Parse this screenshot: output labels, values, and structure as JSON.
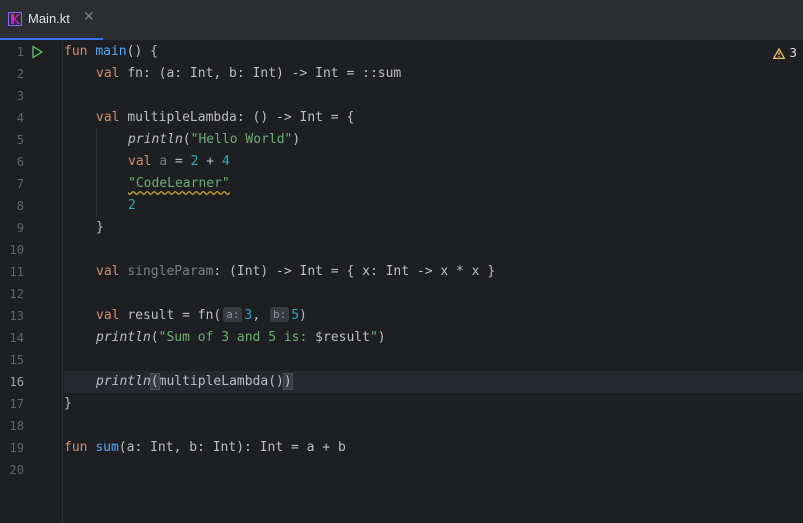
{
  "tab": {
    "filename": "Main.kt",
    "close": "✕"
  },
  "warnings": {
    "count": "3"
  },
  "editor": {
    "current_line": 16,
    "line_numbers": [
      "1",
      "2",
      "3",
      "4",
      "5",
      "6",
      "7",
      "8",
      "9",
      "10",
      "11",
      "12",
      "13",
      "14",
      "15",
      "16",
      "17",
      "18",
      "19",
      "20"
    ]
  },
  "colors": {
    "keyword": "#cf8e6d",
    "function": "#56a8f5",
    "string": "#6aab73",
    "number": "#2aacb8",
    "text": "#bcbec4",
    "accent": "#3574f0"
  },
  "icons": {
    "tab_file": "kotlin-file-icon",
    "run": "run-gutter-icon",
    "warning": "warning-icon"
  },
  "code": {
    "l1": {
      "kw": "fun",
      "fn": "main",
      "rest": "() {"
    },
    "l2": {
      "kw": "val",
      "rest": "fn: (a: Int, b: Int) -> Int = ::sum"
    },
    "l4": {
      "kw": "val",
      "rest": "multipleLambda: () -> Int = {"
    },
    "l5": {
      "call": "println",
      "open": "(",
      "str": "\"Hello World\"",
      "close": ")"
    },
    "l6": {
      "kw": "val",
      "var": "a",
      "eq": "=",
      "n1": "2",
      "plus": "+",
      "n2": "4"
    },
    "l7": {
      "str": "\"CodeLearner\""
    },
    "l8": {
      "num": "2"
    },
    "l9": {
      "text": "}"
    },
    "l11": {
      "kw": "val",
      "var": "singleParam",
      "rest": ": (Int) -> Int = { x: Int -> x * x }"
    },
    "l13": {
      "kw": "val",
      "lhs": "result = fn(",
      "hint_a": "a:",
      "n1": "3",
      "comma": ",",
      "hint_b": "b:",
      "n2": "5",
      "close": ")"
    },
    "l14": {
      "call": "println",
      "open": "(",
      "str1": "\"Sum of 3 and 5 is: ",
      "tmpl": "$result",
      "str2": "\"",
      "close": ")"
    },
    "l16": {
      "call": "println",
      "open": "(",
      "arg": "multipleLambda()",
      "close": ")"
    },
    "l17": {
      "text": "}"
    },
    "l19": {
      "kw": "fun",
      "fn": "sum",
      "rest": "(a: Int, b: Int): Int = a + b"
    }
  }
}
